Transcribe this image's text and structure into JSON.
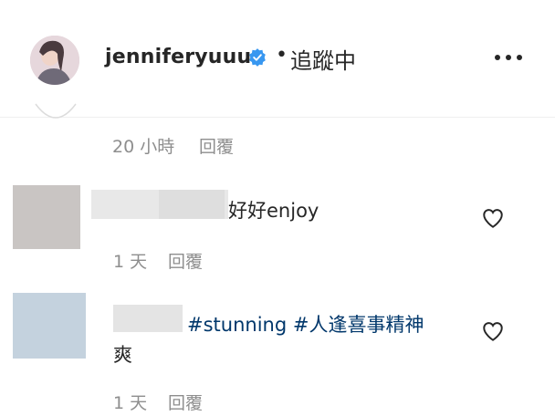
{
  "header": {
    "username": "jenniferyuuu",
    "separator": "•",
    "follow_status": "追蹤中"
  },
  "prev_comment": {
    "time": "20 小時",
    "reply_label": "回覆"
  },
  "comments": [
    {
      "text": "好好enjoy",
      "time": "1 天",
      "reply_label": "回覆"
    },
    {
      "hashtag1": "#stunning",
      "hashtag2": "#人逢喜事精神",
      "text_line2": "爽",
      "time": "1 天",
      "reply_label": "回覆"
    }
  ],
  "icons": {
    "verified": "verified-badge-icon",
    "more": "more-options-icon",
    "like": "heart-icon"
  },
  "colors": {
    "verified_blue": "#3897f0",
    "hashtag": "#00376b",
    "meta_gray": "#8e8e8e"
  }
}
